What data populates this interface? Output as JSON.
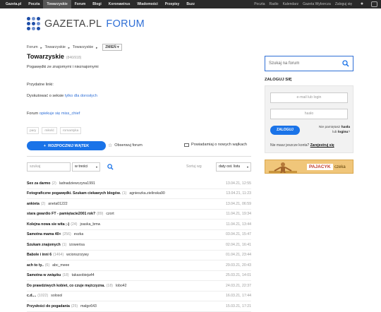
{
  "topbar": {
    "left": [
      "Gazeta.pl",
      "Poczta",
      "Towarzyskie",
      "Forum",
      "Blogi",
      "Koronawirus",
      "Wiadomości",
      "Przepisy",
      "Buzz"
    ],
    "active": "Towarzyskie",
    "right": [
      "Poczta",
      "Radio",
      "Kalendarz",
      "Gazeta Wyborcza",
      "Zaloguj się"
    ]
  },
  "logo": {
    "brand": "GAZETA.PL",
    "section": "FORUM"
  },
  "breadcrumb": {
    "items": [
      "Forum",
      "Towarzyskie",
      "Towarzyskie"
    ],
    "change": "ZMIEŃ"
  },
  "forum": {
    "title": "Towarzyskie",
    "count": "(846/918)",
    "description": "Pogawędki ze znajomymi i nieznajomymi",
    "links_label": "Przydatne linki:",
    "link_prefix": "Dyskutować o seksie",
    "link_text": "tylko dla dorosłych",
    "opiekun_prefix": "Forum",
    "opiekun_link": "opiekuje się miss_chief",
    "tags": [
      "pary",
      "miłość",
      "romantyka"
    ]
  },
  "actions": {
    "new_thread": "ROZPOCZNIJ WĄTEK",
    "observe": "Obserwuj forum",
    "notify": "Powiadamiaj o nowych wątkach"
  },
  "filter": {
    "search_placeholder": "szukaj",
    "scope": "w treści",
    "sort_label": "Sortuj wg",
    "sort_value": "daty ost. listu"
  },
  "threads": [
    {
      "title": "Sex za darmo",
      "count": "(2)",
      "author": "ladnadziewczyna1991",
      "date": "13.04.21, 12:55"
    },
    {
      "title": "Fotograficzne pogawędki. Szukam ciekawych blogów.",
      "count": "(1)",
      "author": "agnieszka.zielinska90",
      "date": "13.04.21, 11:23"
    },
    {
      "title": "ankieta",
      "count": "(2)",
      "author": "aneta01222",
      "date": "13.04.21, 06:59"
    },
    {
      "title": "stara gwardio FT - pamiętacie2001 rok?",
      "count": "(89)",
      "author": "czort",
      "date": "11.04.21, 19:34"
    },
    {
      "title": "Kolejna nowa sie wita ;-)",
      "count": "(24)",
      "author": "joaska_bmw",
      "date": "11.04.21, 13:44"
    },
    {
      "title": "Samotna mama 40+",
      "count": "(256)",
      "author": "evzka",
      "date": "03.04.21, 15:47"
    },
    {
      "title": "Szukam znajomych",
      "count": "(1)",
      "author": "izowerisa",
      "date": "02.04.21, 16:41"
    },
    {
      "title": "Babole i inni 6",
      "count": "(1464)",
      "author": "wcionszrzywy",
      "date": "01.04.21, 23:44"
    },
    {
      "title": "ach to ty..",
      "count": "(6)",
      "author": "abc_meee",
      "date": "29.03.21, 20:43"
    },
    {
      "title": "Samotna w związku",
      "count": "(18)",
      "author": "takasobieja44",
      "date": "25.03.21, 14:01"
    },
    {
      "title": "Do prawdziwych kobiet, co czuje mężczyzna.",
      "count": "(18)",
      "author": "lobo42",
      "date": "24.03.21, 22:37"
    },
    {
      "title": "c.d....",
      "count": "(1022)",
      "author": "solosol",
      "date": "16.03.21, 17:44"
    },
    {
      "title": "Przysłości do pogadania",
      "count": "(25)",
      "author": "malgo643",
      "date": "15.03.21, 17:21"
    }
  ],
  "sidebar": {
    "search_placeholder": "Szukaj na forum",
    "login_title": "ZALOGUJ SIĘ",
    "email_placeholder": "e-mail lub login",
    "pass_placeholder": "hasło",
    "login_btn": "ZALOGUJ",
    "forgot_1": "Nie pamiętasz",
    "forgot_2": "hasła",
    "forgot_3": "lub",
    "forgot_4": "loginu",
    "forgot_5": "?",
    "register_q": "Nie masz jeszcze konta?",
    "register_link": "Zarejestruj się"
  },
  "banner": {
    "brand": "PAJACYK",
    "sub": "czeka"
  },
  "colors": {
    "accent": "#1a73e8",
    "link": "#2f6fd6",
    "topbar": "#2a2a2a",
    "banner": "#f0c67a"
  }
}
